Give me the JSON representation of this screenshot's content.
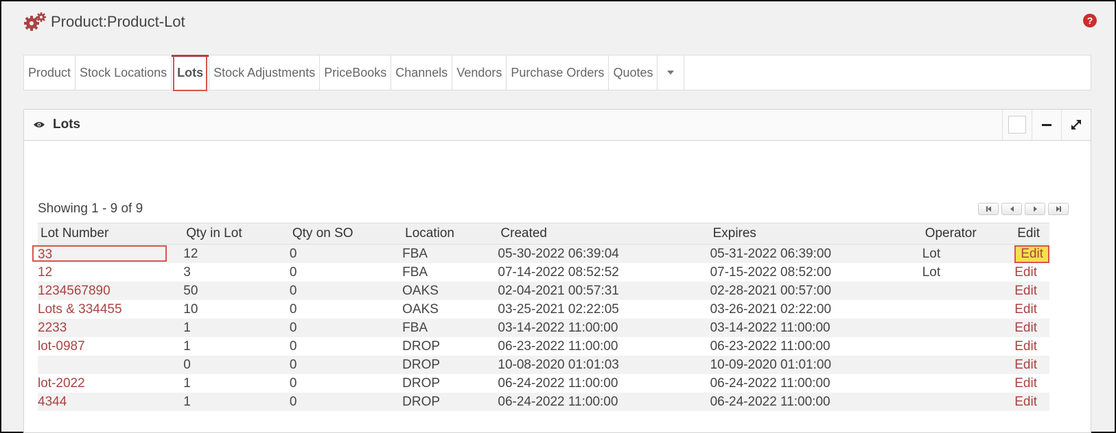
{
  "header": {
    "title": "Product:Product-Lot",
    "help": "?"
  },
  "tabs": [
    {
      "label": "Product"
    },
    {
      "label": "Stock Locations"
    },
    {
      "label": "Lots"
    },
    {
      "label": "Stock Adjustments"
    },
    {
      "label": "PriceBooks"
    },
    {
      "label": "Channels"
    },
    {
      "label": "Vendors"
    },
    {
      "label": "Purchase Orders"
    },
    {
      "label": "Quotes"
    }
  ],
  "panel": {
    "title": "Lots"
  },
  "list": {
    "showing": "Showing 1 - 9 of 9",
    "columns": [
      "Lot Number",
      "Qty in Lot",
      "Qty on SO",
      "Location",
      "Created",
      "Expires",
      "Operator",
      "Edit"
    ],
    "rows": [
      {
        "lot": "33",
        "qty": "12",
        "so": "0",
        "loc": "FBA",
        "created": "05-30-2022 06:39:04",
        "expires": "05-31-2022 06:39:00",
        "operator": "Lot",
        "edit": "Edit"
      },
      {
        "lot": "12",
        "qty": "3",
        "so": "0",
        "loc": "FBA",
        "created": "07-14-2022 08:52:52",
        "expires": "07-15-2022 08:52:00",
        "operator": "Lot",
        "edit": "Edit"
      },
      {
        "lot": "1234567890",
        "qty": "50",
        "so": "0",
        "loc": "OAKS",
        "created": "02-04-2021 00:57:31",
        "expires": "02-28-2021 00:57:00",
        "operator": "",
        "edit": "Edit"
      },
      {
        "lot": "Lots & 334455",
        "qty": "10",
        "so": "0",
        "loc": "OAKS",
        "created": "03-25-2021 02:22:05",
        "expires": "03-26-2021 02:22:00",
        "operator": "",
        "edit": "Edit"
      },
      {
        "lot": "2233",
        "qty": "1",
        "so": "0",
        "loc": "FBA",
        "created": "03-14-2022 11:00:00",
        "expires": "03-14-2022 11:00:00",
        "operator": "",
        "edit": "Edit"
      },
      {
        "lot": "lot-0987",
        "qty": "1",
        "so": "0",
        "loc": "DROP",
        "created": "06-23-2022 11:00:00",
        "expires": "06-23-2022 11:00:00",
        "operator": "",
        "edit": "Edit"
      },
      {
        "lot": "",
        "qty": "0",
        "so": "0",
        "loc": "DROP",
        "created": "10-08-2020 01:01:03",
        "expires": "10-09-2020 01:01:00",
        "operator": "",
        "edit": "Edit"
      },
      {
        "lot": "lot-2022",
        "qty": "1",
        "so": "0",
        "loc": "DROP",
        "created": "06-24-2022 11:00:00",
        "expires": "06-24-2022 11:00:00",
        "operator": "",
        "edit": "Edit"
      },
      {
        "lot": "4344",
        "qty": "1",
        "so": "0",
        "loc": "DROP",
        "created": "06-24-2022 11:00:00",
        "expires": "06-24-2022 11:00:00",
        "operator": "",
        "edit": "Edit"
      }
    ]
  },
  "colors": {
    "accent": "#a94442",
    "expired": "#d42020",
    "highlight": "#f4e04d"
  }
}
